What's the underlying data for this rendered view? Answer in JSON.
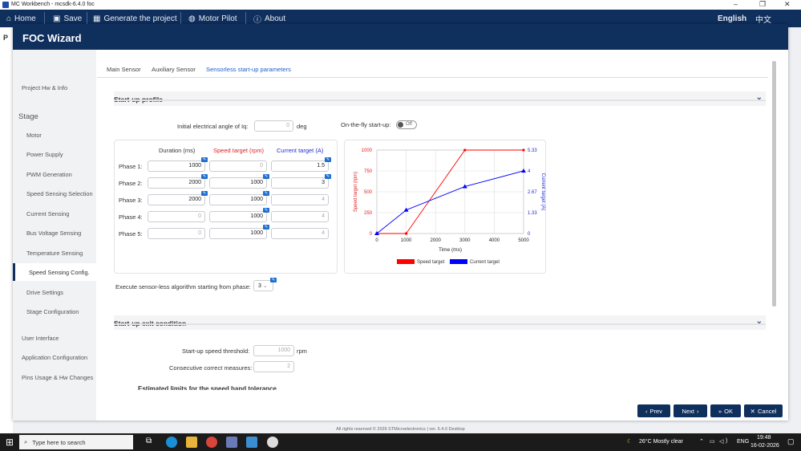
{
  "os": {
    "window_title": "MC Workbench - mcsdk-6.4.0 foc",
    "window_controls": [
      "–",
      "❐",
      "✕"
    ]
  },
  "menu": {
    "home": "Home",
    "save": "Save",
    "generate": "Generate the project",
    "motor_pilot": "Motor Pilot",
    "about": "About",
    "language": "English",
    "language_alt": "中文"
  },
  "wizard": {
    "title": "FOC Wizard",
    "sidebar": {
      "project": "Project Hw & Info",
      "stage_label": "Stage",
      "items": [
        "Motor",
        "Power Supply",
        "PWM Generation",
        "Speed Sensing Selection",
        "Current Sensing",
        "Bus Voltage Sensing",
        "Temperature Sensing",
        "Speed Sensing Config.",
        "Drive Settings",
        "Stage Configuration"
      ],
      "active_item": "Speed Sensing Config.",
      "bottom": [
        "User Interface",
        "Application Configuration",
        "Pins Usage & Hw Changes"
      ]
    },
    "tabs": [
      "Main Sensor",
      "Auxiliary Sensor",
      "Sensorless start-up parameters"
    ],
    "active_tab": "Sensorless start-up parameters",
    "startup_profile": {
      "title": "Start-up profile",
      "initial_angle_label": "Initial electrical angle of Iq:",
      "initial_angle_value": "0",
      "initial_angle_unit": "deg",
      "onthefly_label": "On-the-fly start-up:",
      "onthefly_value": "Off",
      "columns": [
        "Duration (ms)",
        "Speed target (rpm)",
        "Current target (A)"
      ],
      "phases": [
        {
          "label": "Phase 1:",
          "duration": "1000",
          "speed": "0",
          "current": "1.5"
        },
        {
          "label": "Phase 2:",
          "duration": "2000",
          "speed": "1000",
          "current": "3"
        },
        {
          "label": "Phase 3:",
          "duration": "2000",
          "speed": "1000",
          "current": "4"
        },
        {
          "label": "Phase 4:",
          "duration": "0",
          "speed": "1000",
          "current": "4"
        },
        {
          "label": "Phase 5:",
          "duration": "0",
          "speed": "1000",
          "current": "4"
        }
      ],
      "execute_label": "Execute sensor-less algorithm starting from phase:",
      "execute_value": "3"
    },
    "exit_condition": {
      "title": "Start-up exit condition",
      "speed_threshold_label": "Start-up speed threshold:",
      "speed_threshold_value": "1000",
      "speed_threshold_unit": "rpm",
      "consecutive_label": "Consecutive correct measures:",
      "consecutive_value": "2",
      "estimated_label": "Estimated limits for the speed band tolerance"
    },
    "buttons": {
      "prev": "Prev",
      "next": "Next",
      "ok": "OK",
      "cancel": "Cancel"
    }
  },
  "chart_data": {
    "type": "line",
    "xlabel": "Time (ms)",
    "ylabel_left": "Speed target (rpm)",
    "ylabel_right": "Current target (A)",
    "x_ticks": [
      "0",
      "1000",
      "2000",
      "3000",
      "4000",
      "5000"
    ],
    "y_left_ticks": [
      "0",
      "250",
      "500",
      "750",
      "1000"
    ],
    "y_right_ticks": [
      "0",
      "1.33",
      "2.67",
      "4",
      "5.33"
    ],
    "xlim": [
      0,
      5000
    ],
    "ylim_left": [
      0,
      1000
    ],
    "ylim_right": [
      0,
      5.33
    ],
    "grid": true,
    "legend_position": "bottom",
    "series": [
      {
        "name": "Speed target",
        "axis": "left",
        "color": "#ff0000",
        "x": [
          0,
          1000,
          3000,
          5000
        ],
        "y": [
          0,
          0,
          1000,
          1000
        ]
      },
      {
        "name": "Current target",
        "axis": "right",
        "color": "#0000ff",
        "x": [
          0,
          1000,
          3000,
          5000
        ],
        "y": [
          0,
          1.5,
          3,
          4
        ]
      }
    ]
  },
  "footer": "All rights reserved © 2026 STMicroelectronics | ver. 6.4.0 Desktop",
  "taskbar": {
    "search_placeholder": "Type here to search",
    "weather": "26°C  Mostly clear",
    "lang": "ENG",
    "time": "19:48",
    "date": "16-02-2026"
  },
  "colors": {
    "navy": "#0f2f5d",
    "accent": "#1f5fcc",
    "speed": "#ff0000",
    "current": "#0000ff"
  }
}
